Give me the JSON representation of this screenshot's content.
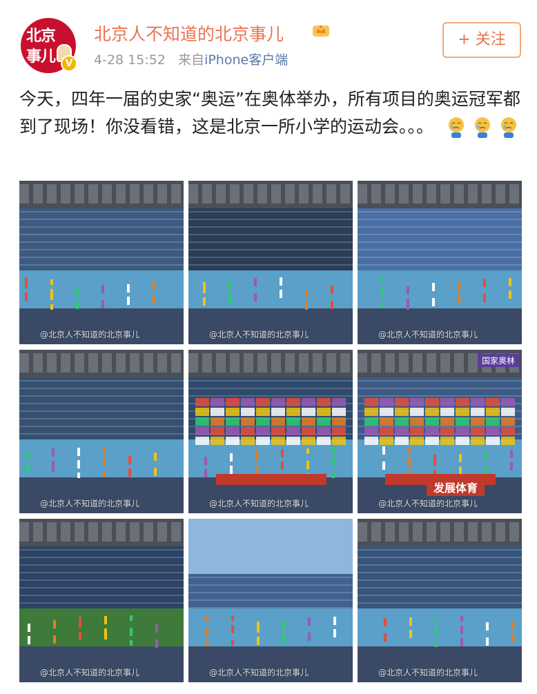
{
  "header": {
    "username": "北京人不知道的北京事儿",
    "timestamp": "4-28 15:52",
    "source_prefix": "来自",
    "source": "iPhone客户端",
    "follow_label": "+ 关注",
    "avatar": {
      "line1": "北京",
      "line2": "事儿",
      "verified_icon": "verified-v-icon"
    },
    "vip_icon": "crown-icon"
  },
  "post": {
    "text": "今天，四年一届的史家“奥运”在奥体举办，所有项目的奥运冠军都到了现场！你没看错，这是北京一所小学的运动会。。。",
    "emojis": [
      "crying-face-emoji",
      "crying-face-emoji",
      "crying-face-emoji"
    ]
  },
  "photos": {
    "watermark": "@北京人不知道的北京事儿",
    "count": 9,
    "banner_text": [
      "国家奥林",
      "发展体育"
    ]
  },
  "colors": {
    "accent": "#eb7350",
    "source_link": "#5b7aa8",
    "meta": "#999999",
    "brand_red": "#c8102e"
  }
}
